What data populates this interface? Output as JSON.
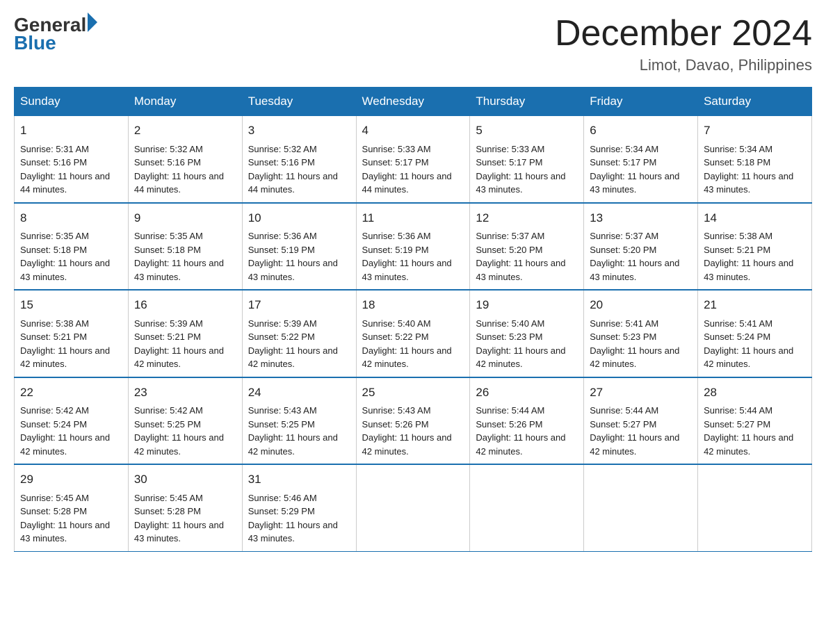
{
  "logo": {
    "general": "General",
    "blue": "Blue",
    "arrow": "▶"
  },
  "header": {
    "month_year": "December 2024",
    "location": "Limot, Davao, Philippines"
  },
  "weekdays": [
    "Sunday",
    "Monday",
    "Tuesday",
    "Wednesday",
    "Thursday",
    "Friday",
    "Saturday"
  ],
  "weeks": [
    [
      {
        "day": "1",
        "sunrise": "5:31 AM",
        "sunset": "5:16 PM",
        "daylight": "11 hours and 44 minutes."
      },
      {
        "day": "2",
        "sunrise": "5:32 AM",
        "sunset": "5:16 PM",
        "daylight": "11 hours and 44 minutes."
      },
      {
        "day": "3",
        "sunrise": "5:32 AM",
        "sunset": "5:16 PM",
        "daylight": "11 hours and 44 minutes."
      },
      {
        "day": "4",
        "sunrise": "5:33 AM",
        "sunset": "5:17 PM",
        "daylight": "11 hours and 44 minutes."
      },
      {
        "day": "5",
        "sunrise": "5:33 AM",
        "sunset": "5:17 PM",
        "daylight": "11 hours and 43 minutes."
      },
      {
        "day": "6",
        "sunrise": "5:34 AM",
        "sunset": "5:17 PM",
        "daylight": "11 hours and 43 minutes."
      },
      {
        "day": "7",
        "sunrise": "5:34 AM",
        "sunset": "5:18 PM",
        "daylight": "11 hours and 43 minutes."
      }
    ],
    [
      {
        "day": "8",
        "sunrise": "5:35 AM",
        "sunset": "5:18 PM",
        "daylight": "11 hours and 43 minutes."
      },
      {
        "day": "9",
        "sunrise": "5:35 AM",
        "sunset": "5:18 PM",
        "daylight": "11 hours and 43 minutes."
      },
      {
        "day": "10",
        "sunrise": "5:36 AM",
        "sunset": "5:19 PM",
        "daylight": "11 hours and 43 minutes."
      },
      {
        "day": "11",
        "sunrise": "5:36 AM",
        "sunset": "5:19 PM",
        "daylight": "11 hours and 43 minutes."
      },
      {
        "day": "12",
        "sunrise": "5:37 AM",
        "sunset": "5:20 PM",
        "daylight": "11 hours and 43 minutes."
      },
      {
        "day": "13",
        "sunrise": "5:37 AM",
        "sunset": "5:20 PM",
        "daylight": "11 hours and 43 minutes."
      },
      {
        "day": "14",
        "sunrise": "5:38 AM",
        "sunset": "5:21 PM",
        "daylight": "11 hours and 43 minutes."
      }
    ],
    [
      {
        "day": "15",
        "sunrise": "5:38 AM",
        "sunset": "5:21 PM",
        "daylight": "11 hours and 42 minutes."
      },
      {
        "day": "16",
        "sunrise": "5:39 AM",
        "sunset": "5:21 PM",
        "daylight": "11 hours and 42 minutes."
      },
      {
        "day": "17",
        "sunrise": "5:39 AM",
        "sunset": "5:22 PM",
        "daylight": "11 hours and 42 minutes."
      },
      {
        "day": "18",
        "sunrise": "5:40 AM",
        "sunset": "5:22 PM",
        "daylight": "11 hours and 42 minutes."
      },
      {
        "day": "19",
        "sunrise": "5:40 AM",
        "sunset": "5:23 PM",
        "daylight": "11 hours and 42 minutes."
      },
      {
        "day": "20",
        "sunrise": "5:41 AM",
        "sunset": "5:23 PM",
        "daylight": "11 hours and 42 minutes."
      },
      {
        "day": "21",
        "sunrise": "5:41 AM",
        "sunset": "5:24 PM",
        "daylight": "11 hours and 42 minutes."
      }
    ],
    [
      {
        "day": "22",
        "sunrise": "5:42 AM",
        "sunset": "5:24 PM",
        "daylight": "11 hours and 42 minutes."
      },
      {
        "day": "23",
        "sunrise": "5:42 AM",
        "sunset": "5:25 PM",
        "daylight": "11 hours and 42 minutes."
      },
      {
        "day": "24",
        "sunrise": "5:43 AM",
        "sunset": "5:25 PM",
        "daylight": "11 hours and 42 minutes."
      },
      {
        "day": "25",
        "sunrise": "5:43 AM",
        "sunset": "5:26 PM",
        "daylight": "11 hours and 42 minutes."
      },
      {
        "day": "26",
        "sunrise": "5:44 AM",
        "sunset": "5:26 PM",
        "daylight": "11 hours and 42 minutes."
      },
      {
        "day": "27",
        "sunrise": "5:44 AM",
        "sunset": "5:27 PM",
        "daylight": "11 hours and 42 minutes."
      },
      {
        "day": "28",
        "sunrise": "5:44 AM",
        "sunset": "5:27 PM",
        "daylight": "11 hours and 42 minutes."
      }
    ],
    [
      {
        "day": "29",
        "sunrise": "5:45 AM",
        "sunset": "5:28 PM",
        "daylight": "11 hours and 43 minutes."
      },
      {
        "day": "30",
        "sunrise": "5:45 AM",
        "sunset": "5:28 PM",
        "daylight": "11 hours and 43 minutes."
      },
      {
        "day": "31",
        "sunrise": "5:46 AM",
        "sunset": "5:29 PM",
        "daylight": "11 hours and 43 minutes."
      },
      null,
      null,
      null,
      null
    ]
  ],
  "labels": {
    "sunrise": "Sunrise:",
    "sunset": "Sunset:",
    "daylight": "Daylight:"
  }
}
